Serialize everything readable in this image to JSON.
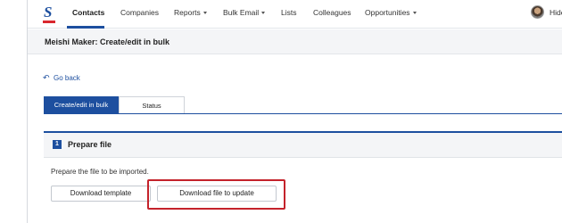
{
  "nav": {
    "logo_letter": "S",
    "items": [
      {
        "label": "Contacts",
        "active": true
      },
      {
        "label": "Companies"
      },
      {
        "label": "Reports"
      },
      {
        "label": "Bulk Email"
      },
      {
        "label": "Lists"
      },
      {
        "label": "Colleagues"
      },
      {
        "label": "Opportunities"
      }
    ],
    "user_name": "Hide"
  },
  "page": {
    "title": "Meishi Maker: Create/edit in bulk",
    "go_back": "Go back"
  },
  "tabs": [
    {
      "label": "Create/edit in bulk",
      "active": true
    },
    {
      "label": "Status",
      "active": false
    }
  ],
  "section": {
    "step": "1",
    "title": "Prepare file",
    "description": "Prepare the file to be imported.",
    "buttons": {
      "template": "Download template",
      "update": "Download file to update"
    }
  },
  "colors": {
    "brand_blue": "#1d4f9f",
    "brand_red": "#d9272e",
    "highlight": "#c4222b"
  },
  "icons": {
    "back": "back-arrow-icon",
    "caret": "caret-down-icon",
    "avatar": "user-avatar"
  }
}
